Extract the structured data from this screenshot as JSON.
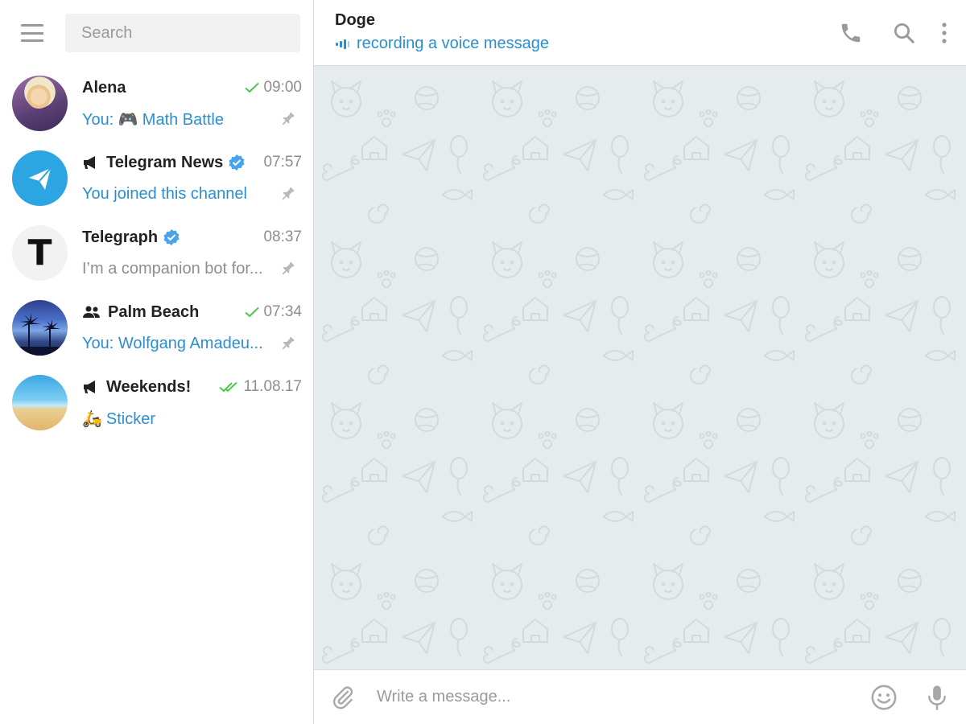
{
  "search": {
    "placeholder": "Search"
  },
  "chats": [
    {
      "name": "Alena",
      "time": "09:00",
      "status": "sent",
      "preview_prefix": "You: ",
      "preview_emoji": "🎮",
      "preview": "Math Battle",
      "pinned": true,
      "avatar": "alena-photo"
    },
    {
      "name": "Telegram News",
      "time": "07:57",
      "verified": true,
      "type": "channel",
      "preview": "You joined this channel",
      "pinned": true,
      "avatar": "telegram-logo"
    },
    {
      "name": "Telegraph",
      "time": "08:37",
      "verified": true,
      "preview": "I’m a companion bot for...",
      "preview_grey": true,
      "pinned": true,
      "avatar_letter": "T"
    },
    {
      "name": "Palm Beach",
      "time": "07:34",
      "status": "sent",
      "type": "group",
      "preview_prefix": "You: ",
      "preview": "Wolfgang Amadeu...",
      "pinned": true,
      "avatar": "palm-trees-photo"
    },
    {
      "name": "Weekends!",
      "time": "11.08.17",
      "status": "read",
      "type": "channel",
      "preview_emoji": "🛵",
      "preview": "Sticker",
      "pinned": false,
      "avatar": "beach-photo"
    }
  ],
  "header": {
    "title": "Doge",
    "typing": "recording a voice message"
  },
  "composer": {
    "placeholder": "Write a message..."
  },
  "colors": {
    "accent": "#2b8fcf",
    "check": "#4cc84a",
    "background": "#e6ebee"
  }
}
